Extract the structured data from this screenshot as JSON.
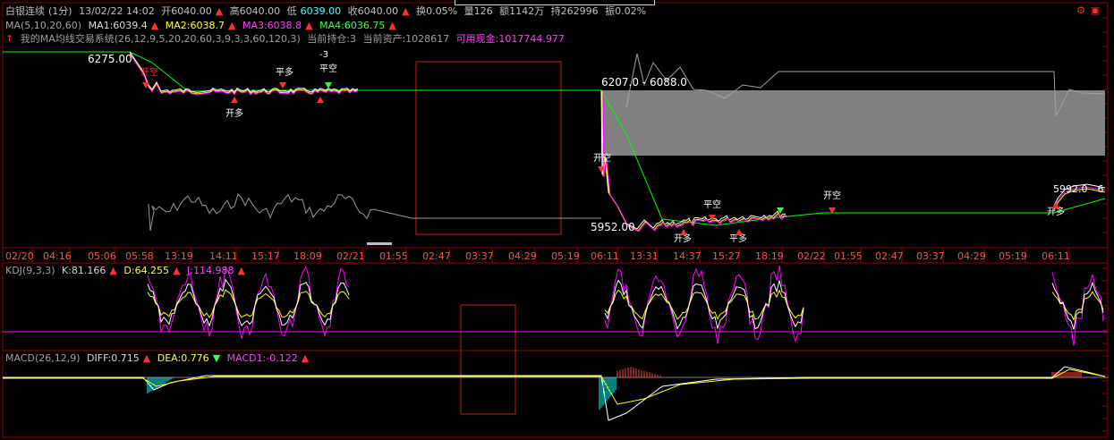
{
  "header": {
    "name": "白银连续",
    "period": "(1分)",
    "datetime": "13/02/22 14:02",
    "open": "开6040.00",
    "high": "高6040.00",
    "low_label": "低",
    "low_value": "6039.00",
    "close": "收6040.00",
    "turnover": "换0.05%",
    "volume": "量126",
    "amount": "额1142万",
    "position": "持262996",
    "amplitude": "振0.02%"
  },
  "ma": {
    "label": "MA(5,10,20,60)",
    "ma1": "MA1:6039.4",
    "ma2": "MA2:6038.7",
    "ma3": "MA3:6038.8",
    "ma4": "MA4:6036.75"
  },
  "system": {
    "arrow": "↑",
    "label": "我的MA均线交易系统(26,12,9,5,20,20,60,3,9,3,3,60,120,3)",
    "holding": "当前持仓:3",
    "assets": "当前资产:1028617",
    "cash": "可用现金:1017744.977"
  },
  "kdj": {
    "label": "KDJ(9,3,3)",
    "k": "K:81.166",
    "d": "D:64.255",
    "j": "J:114.988"
  },
  "macd": {
    "label": "MACD(26,12,9)",
    "diff": "DIFF:0.715",
    "dea": "DEA:0.776",
    "macd1": "MACD1:-0.122"
  },
  "colors": {
    "background": "#000000",
    "grid_red": "#8b0000",
    "price_white": "#ffffff",
    "ma_yellow": "#ffff00",
    "ma_magenta": "#ff00ff",
    "ma_green": "#00ff00",
    "bar_cyan": "#00ffff",
    "bar_red": "#ff4040",
    "band_gray": "#808080"
  },
  "icons": [
    "settings-icon",
    "toggle-icon"
  ],
  "chart_data": {
    "type": "line",
    "x_tick_labels": [
      "02/20",
      "04:16",
      "05:06",
      "05:58",
      "13:19",
      "14:11",
      "15:17",
      "18:09",
      "02/21",
      "01:55",
      "02:47",
      "03:37",
      "04:29",
      "05:19",
      "06:11",
      "13:31",
      "14:37",
      "15:27",
      "18:19",
      "02/22",
      "01:55",
      "02:47",
      "03:37",
      "04:29",
      "05:19",
      "06:11"
    ],
    "price_annotations": [
      "6275.00",
      "6207.0 - 6088.0",
      "5952.00",
      "5992.0 - 6"
    ],
    "signals": [
      {
        "text": "开空",
        "day": "02/20"
      },
      {
        "text": "平多",
        "day": "02/20"
      },
      {
        "text": "开多",
        "day": "02/20"
      },
      {
        "text": "-3",
        "day": "02/20"
      },
      {
        "text": "平空",
        "day": "02/20"
      },
      {
        "text": "开空",
        "day": "02/21"
      },
      {
        "text": "平空",
        "day": "02/21"
      },
      {
        "text": "开多",
        "day": "02/21"
      },
      {
        "text": "平多",
        "day": "02/21"
      },
      {
        "text": "开空",
        "day": "02/22"
      },
      {
        "text": "开多",
        "day": "02/22"
      }
    ],
    "series": [
      {
        "name": "MA1",
        "value": 6039.4
      },
      {
        "name": "MA2",
        "value": 6038.7
      },
      {
        "name": "MA3",
        "value": 6038.8
      },
      {
        "name": "MA4",
        "value": 6036.75
      }
    ]
  }
}
